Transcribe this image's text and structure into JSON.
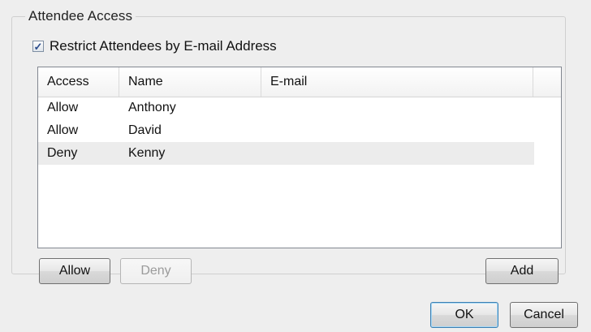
{
  "group": {
    "title": "Attendee Access"
  },
  "restrict": {
    "label": "Restrict Attendees by E-mail Address",
    "checked": true,
    "check_glyph": "✓"
  },
  "list": {
    "columns": {
      "access": "Access",
      "name": "Name",
      "email": "E-mail"
    },
    "rows": [
      {
        "access": "Allow",
        "name": "Anthony",
        "email": "",
        "selected": false
      },
      {
        "access": "Allow",
        "name": "David",
        "email": "",
        "selected": false
      },
      {
        "access": "Deny",
        "name": "Kenny",
        "email": "",
        "selected": true
      }
    ]
  },
  "buttons": {
    "allow": "Allow",
    "deny": "Deny",
    "add": "Add",
    "ok": "OK",
    "cancel": "Cancel"
  },
  "colors": {
    "dialog_bg": "#eeeeee",
    "selected_row": "#ececec",
    "default_button_border": "#3c7fb1"
  }
}
